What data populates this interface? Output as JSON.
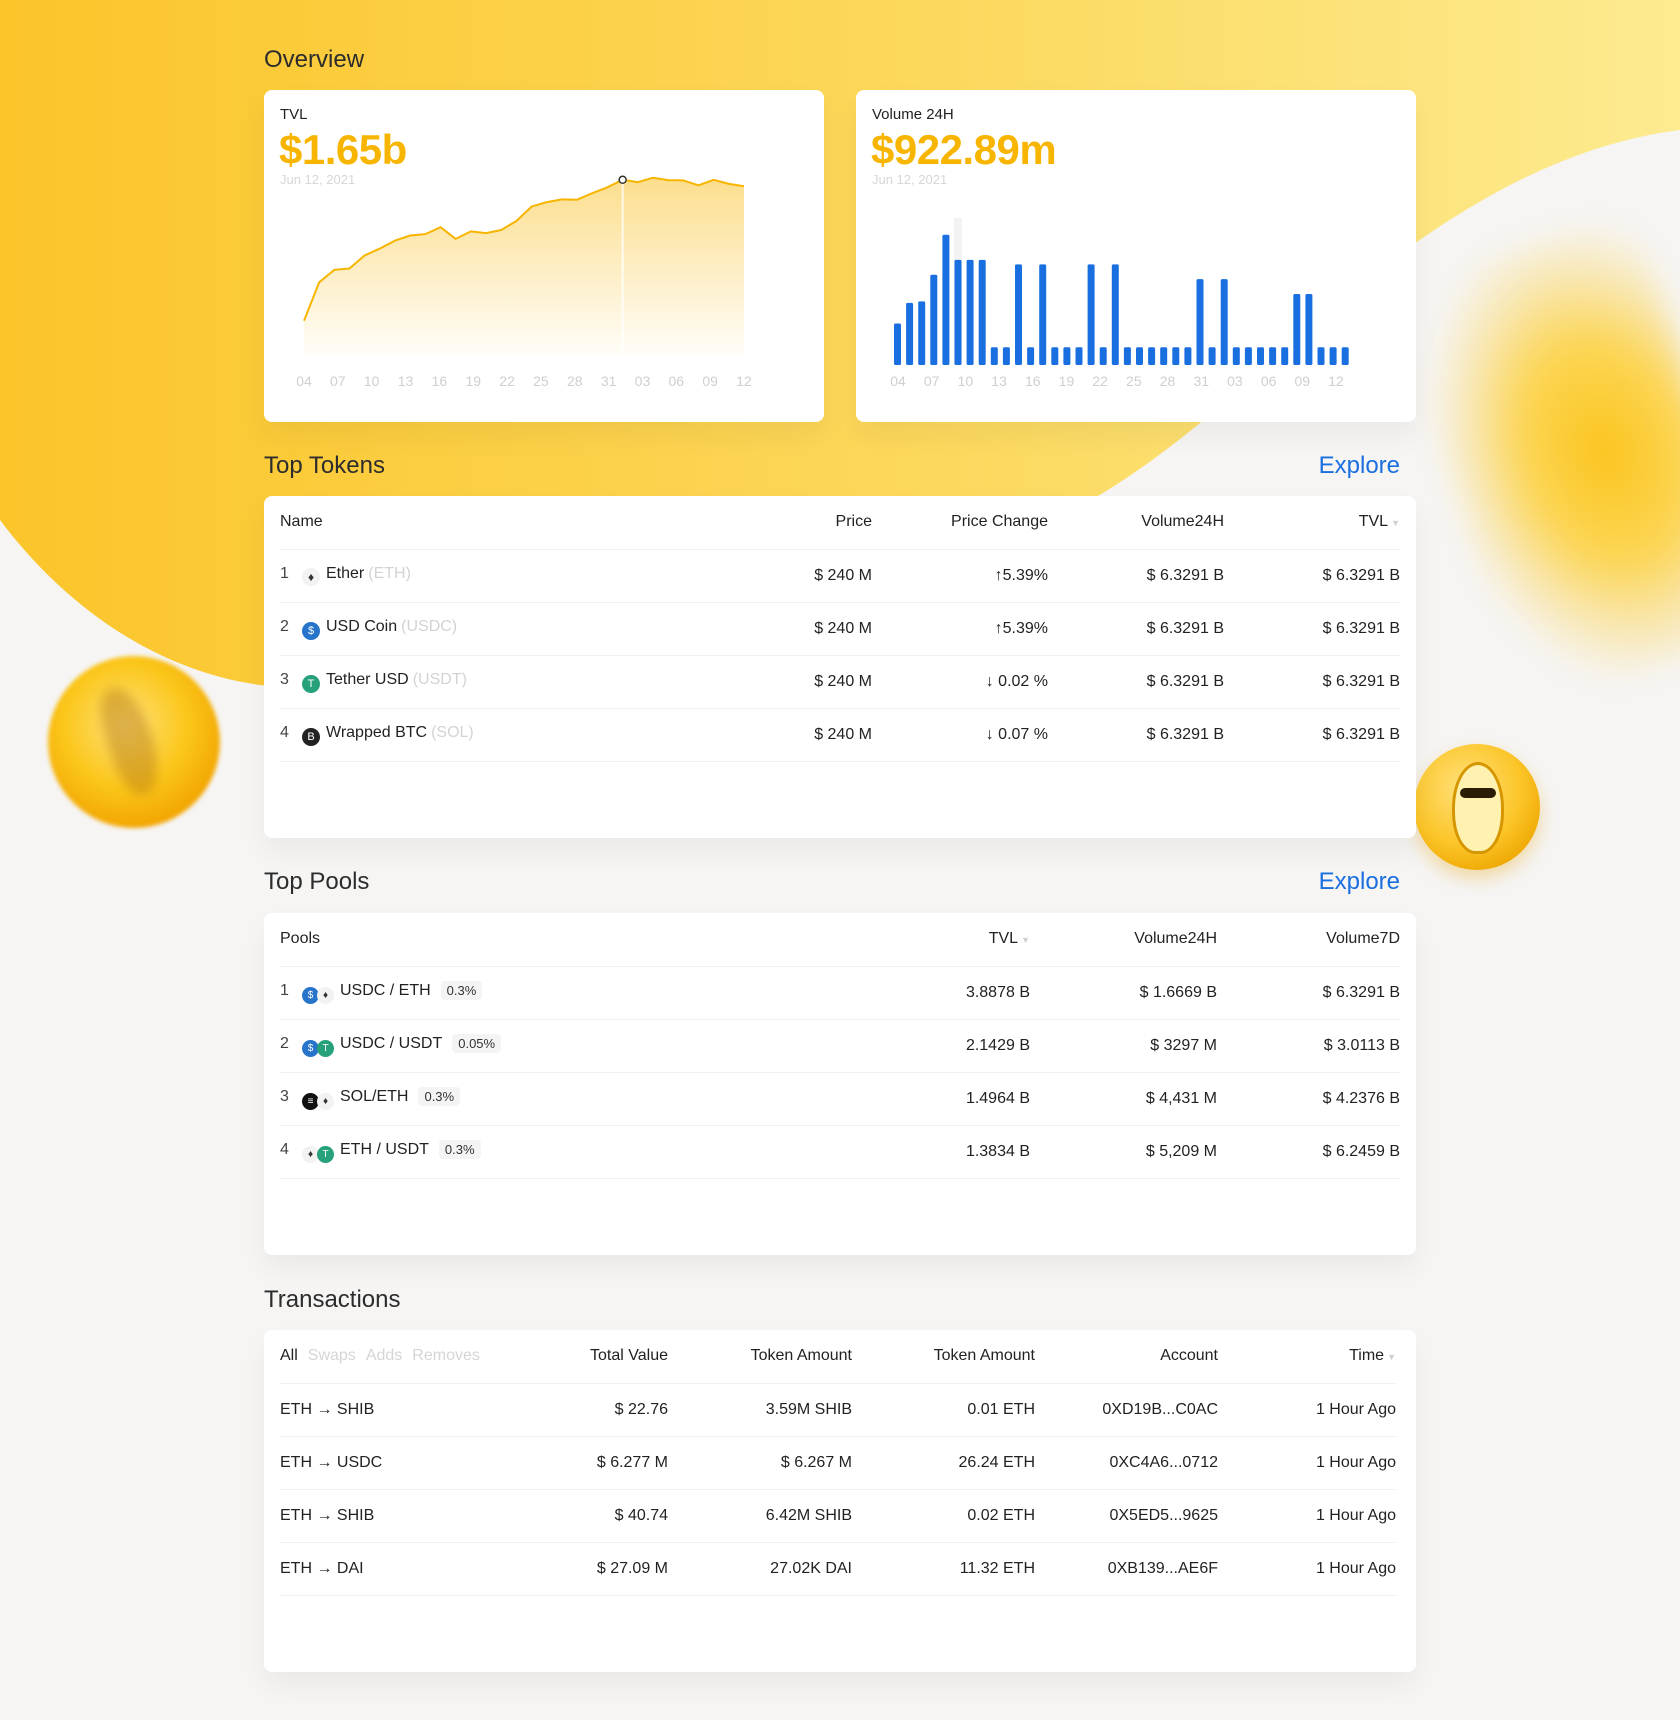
{
  "overview": {
    "title": "Overview",
    "tvl": {
      "label": "TVL",
      "value": "$1.65b",
      "date": "Jun 12, 2021"
    },
    "volume": {
      "label": "Volume 24H",
      "value": "$922.89m",
      "date": "Jun 12, 2021"
    }
  },
  "chart_data": [
    {
      "type": "area",
      "title": "",
      "x_ticks": [
        "04",
        "07",
        "10",
        "13",
        "16",
        "19",
        "22",
        "25",
        "28",
        "31",
        "03",
        "06",
        "09",
        "12"
      ],
      "series": [
        {
          "values": [
            150,
            262,
            298,
            302,
            340,
            360,
            383,
            398,
            402,
            422,
            388,
            410,
            405,
            414,
            440,
            482,
            495,
            503,
            502,
            521,
            538,
            560,
            553,
            566,
            559,
            558,
            544,
            560,
            548,
            541
          ]
        }
      ],
      "color": "#f7b500",
      "highlight_index": 21
    },
    {
      "type": "bar",
      "title": "",
      "x_ticks": [
        "04",
        "07",
        "10",
        "13",
        "16",
        "19",
        "22",
        "25",
        "28",
        "31",
        "03",
        "06",
        "09",
        "12"
      ],
      "series": [
        {
          "values": [
            28,
            42,
            43,
            61,
            88,
            71,
            71,
            71,
            12,
            12,
            68,
            12,
            68,
            12,
            12,
            12,
            68,
            12,
            68,
            12,
            12,
            12,
            12,
            12,
            12,
            58,
            12,
            58,
            12,
            12,
            12,
            12,
            12,
            48,
            48,
            12,
            12,
            12
          ]
        }
      ],
      "color": "#1a6fe0",
      "highlight_index": 5
    }
  ],
  "top_tokens": {
    "title": "Top Tokens",
    "explore": "Explore",
    "columns": [
      "Name",
      "Price",
      "Price Change",
      "Volume24H",
      "TVL"
    ],
    "rows": [
      {
        "rank": "1",
        "icon": "eth-icon",
        "glyph": "♦",
        "name": "Ether",
        "symbol": "(ETH)",
        "price": "$ 240 M",
        "change": "5.39%",
        "dir": "up",
        "volume": "$ 6.3291 B",
        "tvl": "$ 6.3291 B"
      },
      {
        "rank": "2",
        "icon": "usdc-icon",
        "glyph": "$",
        "name": "USD Coin",
        "symbol": "(USDC)",
        "price": "$ 240 M",
        "change": "5.39%",
        "dir": "up",
        "volume": "$ 6.3291 B",
        "tvl": "$ 6.3291 B"
      },
      {
        "rank": "3",
        "icon": "usdt-icon",
        "glyph": "T",
        "name": "Tether USD",
        "symbol": "(USDT)",
        "price": "$ 240 M",
        "change": "↓ 0.02 %",
        "dir": "down",
        "volume": "$ 6.3291 B",
        "tvl": "$ 6.3291 B"
      },
      {
        "rank": "4",
        "icon": "btc-icon",
        "glyph": "B",
        "name": "Wrapped BTC",
        "symbol": "(SOL)",
        "price": "$ 240 M",
        "change": "↓ 0.07 %",
        "dir": "down",
        "volume": "$ 6.3291 B",
        "tvl": "$ 6.3291 B"
      }
    ]
  },
  "top_pools": {
    "title": "Top Pools",
    "explore": "Explore",
    "columns": [
      "Pools",
      "TVL",
      "Volume24H",
      "Volume7D"
    ],
    "rows": [
      {
        "rank": "1",
        "icons": [
          "usdc-icon",
          "eth-icon"
        ],
        "glyphs": [
          "$",
          "♦"
        ],
        "pair": "USDC / ETH",
        "fee": "0.3%",
        "tvl": "3.8878 B",
        "volume24": "$ 1.6669 B",
        "volume7": "$ 6.3291 B"
      },
      {
        "rank": "2",
        "icons": [
          "usdc-icon",
          "usdt-icon"
        ],
        "glyphs": [
          "$",
          "T"
        ],
        "pair": "USDC / USDT",
        "fee": "0.05%",
        "tvl": "2.1429 B",
        "volume24": "$ 3297 M",
        "volume7": "$ 3.0113 B"
      },
      {
        "rank": "3",
        "icons": [
          "sol-icon",
          "eth-icon"
        ],
        "glyphs": [
          "≡",
          "♦"
        ],
        "pair": "SOL/ETH",
        "fee": "0.3%",
        "tvl": "1.4964 B",
        "volume24": "$ 4,431 M",
        "volume7": "$ 4.2376 B"
      },
      {
        "rank": "4",
        "icons": [
          "eth-icon",
          "usdt-icon"
        ],
        "glyphs": [
          "♦",
          "T"
        ],
        "pair": "ETH / USDT",
        "fee": "0.3%",
        "tvl": "1.3834 B",
        "volume24": "$ 5,209 M",
        "volume7": "$ 6.2459 B"
      }
    ]
  },
  "transactions": {
    "title": "Transactions",
    "tabs": [
      "All",
      "Swaps",
      "Adds",
      "Removes"
    ],
    "columns": [
      "Total Value",
      "Token Amount",
      "Token Amount",
      "Account",
      "Time"
    ],
    "rows": [
      {
        "action": "ETH → SHIB",
        "total": "$ 22.76",
        "amount_a": "3.59M SHIB",
        "amount_b": "0.01 ETH",
        "account": "0XD19B...C0AC",
        "time": "1 Hour Ago"
      },
      {
        "action": "ETH → USDC",
        "total": "$ 6.277 M",
        "amount_a": "$ 6.267 M",
        "amount_b": "26.24 ETH",
        "account": "0XC4A6...0712",
        "time": "1 Hour Ago"
      },
      {
        "action": "ETH → SHIB",
        "total": "$ 40.74",
        "amount_a": "6.42M SHIB",
        "amount_b": "0.02 ETH",
        "account": "0X5ED5...9625",
        "time": "1 Hour Ago"
      },
      {
        "action": "ETH →  DAI",
        "total": "$ 27.09 M",
        "amount_a": "27.02K DAI",
        "amount_b": "11.32 ETH",
        "account": "0XB139...AE6F",
        "time": "1 Hour Ago"
      }
    ]
  },
  "colors": {
    "accent": "#f7b500",
    "link": "#1a6fe0",
    "up": "#17a35a",
    "down": "#e03a3a",
    "bar": "#1a6fe0"
  }
}
